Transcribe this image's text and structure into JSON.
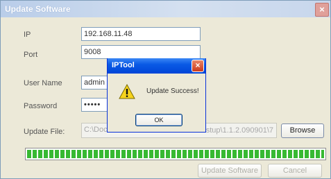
{
  "window": {
    "title": "Update Software",
    "close_glyph": "×"
  },
  "form": {
    "ip_label": "IP",
    "ip_value": "192.168.11.48",
    "port_label": "Port",
    "port_value": "9008",
    "username_label": "User Name",
    "username_value": "admin",
    "password_label": "Password",
    "password_value": "•••••",
    "update_file_label": "Update File:",
    "update_file_value": "C:\\Doc",
    "update_file_value_tail": "stup\\1.1.2.090901\\7",
    "browse_label": "Browse"
  },
  "progress": {
    "fraction": 1.0
  },
  "actions": {
    "update_software_label": "Update Software",
    "cancel_label": "Cancel"
  },
  "dialog": {
    "title": "IPTool",
    "close_glyph": "×",
    "icon": "warning-icon",
    "message": "Update Success!",
    "ok_label": "OK"
  }
}
